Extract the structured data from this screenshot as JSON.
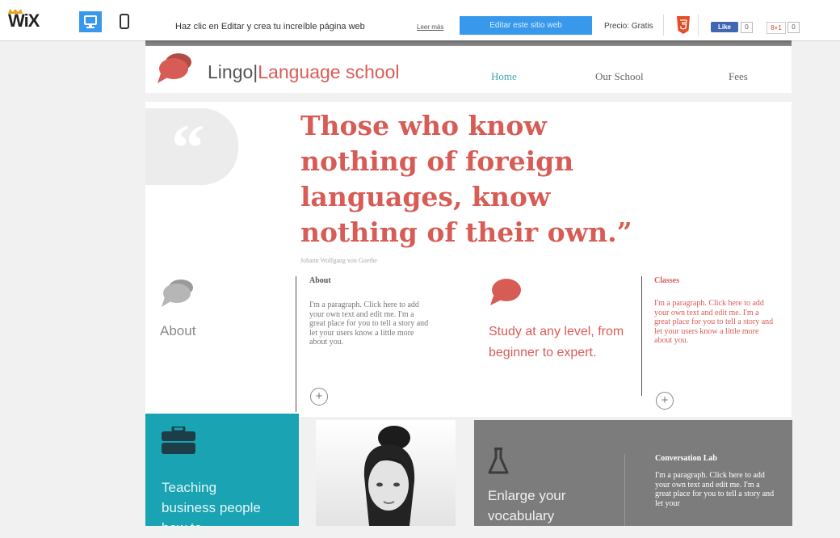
{
  "wix_bar": {
    "logo": "WiX",
    "promo_text": "Haz clic en Editar y crea tu increíble página web",
    "learn_more": "Leer más",
    "edit_button": "Editar este sitio web",
    "price": "Precio: Gratis",
    "fb_like": "Like",
    "fb_count": "0",
    "gplus": "8+1",
    "gplus_count": "0",
    "accent": "#3899ec"
  },
  "site": {
    "name": "Lingo",
    "separator": "|",
    "subtitle": "Language school",
    "nav": [
      "Home",
      "Our School",
      "Fees"
    ],
    "brand_color": "#d85c56",
    "teal_color": "#1aa3b2"
  },
  "hero": {
    "quote_mark": "“",
    "quote": "Those who know nothing of foreign languages, know nothing of their own.”",
    "author": "Johann Wolfgang von Goethe"
  },
  "about": {
    "label": "About",
    "title": "About",
    "text": "I'm a paragraph. Click here to add your own text and edit me. I'm a great place for you to tell a story and let your users know a little more about you."
  },
  "study": {
    "text": "Study at any level, from beginner to expert."
  },
  "classes": {
    "title": "Classes",
    "text": "I'm a paragraph. Click here to add your own text and edit me. I'm a great place for you to tell a story and let your users know a little more about you."
  },
  "teaching": {
    "text": "Teaching business people how to"
  },
  "vocab": {
    "text": "Enlarge your vocabulary"
  },
  "conversation": {
    "title": "Conversation Lab",
    "text": "I'm a paragraph. Click here to add your own text and edit me. I'm a great place for you to tell a story and let your"
  },
  "icons": [
    "wix-crown-icon",
    "desktop-icon",
    "mobile-icon",
    "html5-icon",
    "speech-bubble-icon",
    "quote-icon",
    "briefcase-icon",
    "flask-icon",
    "plus-icon"
  ]
}
